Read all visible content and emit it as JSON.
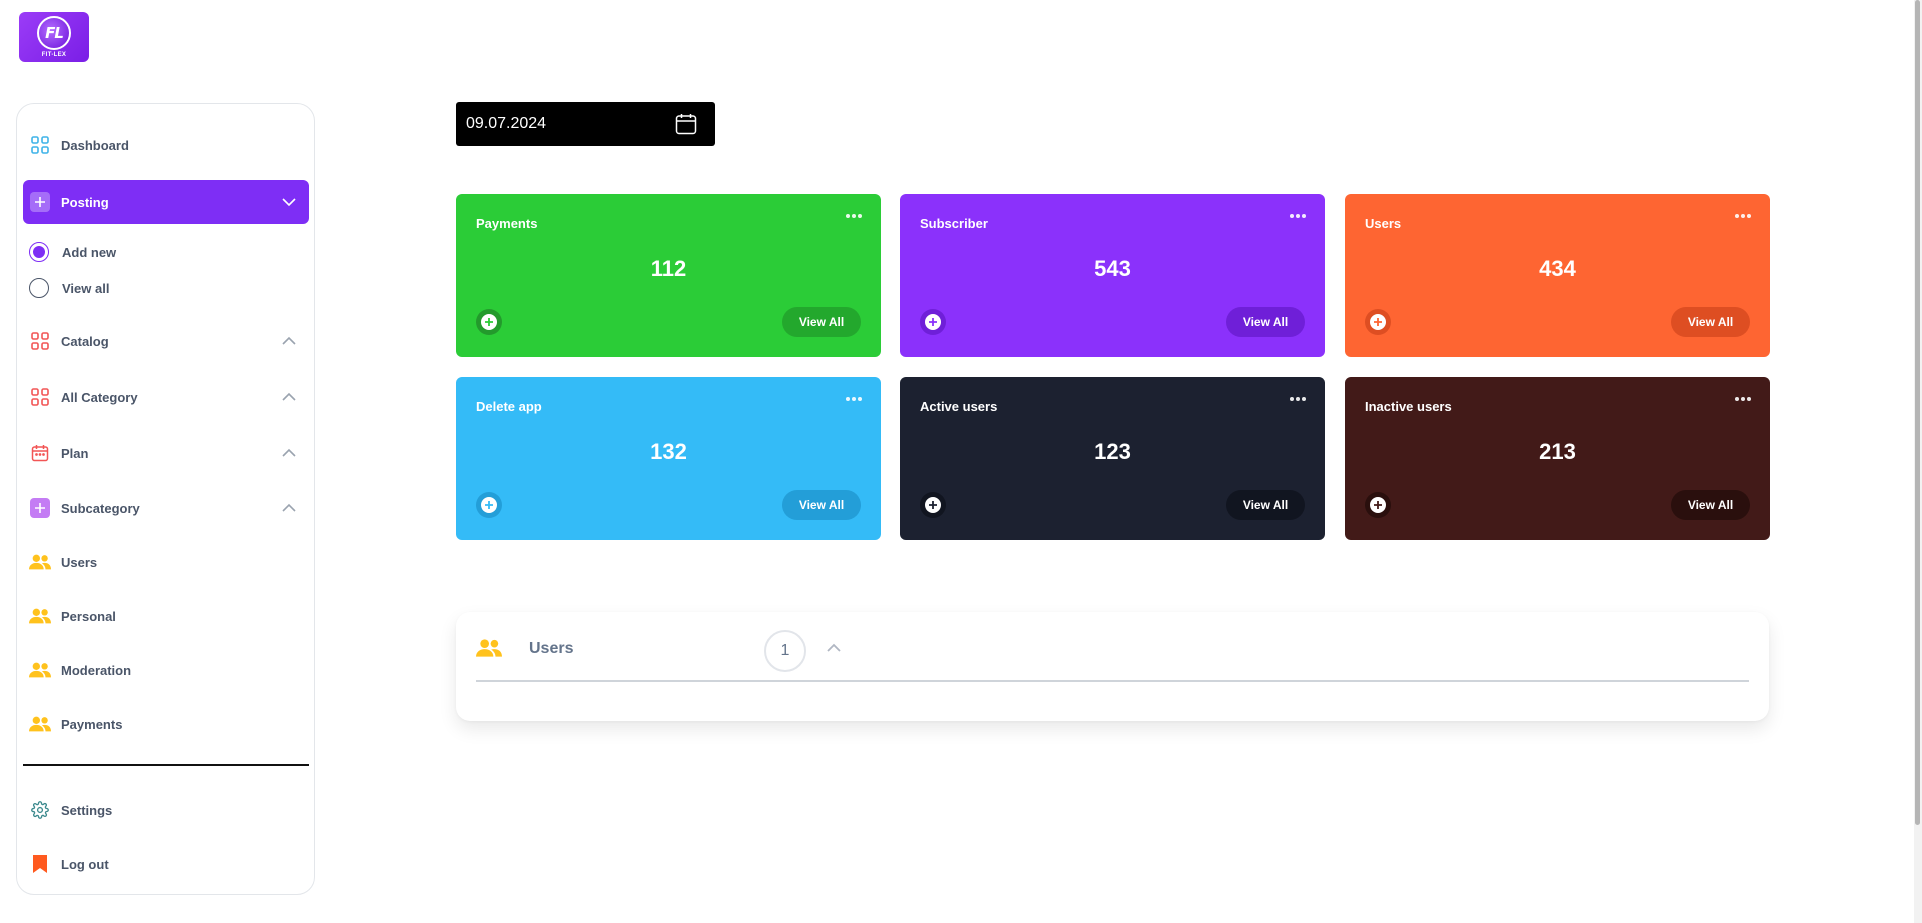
{
  "logo": {
    "letters": "FL",
    "text": "FIT-LEX"
  },
  "sidebar": {
    "dashboard": "Dashboard",
    "posting": "Posting",
    "posting_sub": {
      "add_new": "Add new",
      "view_all": "View all"
    },
    "catalog": "Catalog",
    "all_category": "All Category",
    "plan": "Plan",
    "subcategory": "Subcategory",
    "users": "Users",
    "personal": "Personal",
    "moderation": "Moderation",
    "payments": "Payments",
    "settings": "Settings",
    "logout": "Log out"
  },
  "date": {
    "value": "09.07.2024"
  },
  "cards": [
    {
      "title": "Payments",
      "value": "112",
      "button": "View All",
      "bg": "#2bcc37",
      "btn_bg": "#23a82d",
      "plus_bg": "#239a2c",
      "plus_fg": "#2bcc37"
    },
    {
      "title": "Subscriber",
      "value": "543",
      "button": "View All",
      "bg": "#8b31fb",
      "btn_bg": "#6f1fd8",
      "plus_bg": "#6f1fd8",
      "plus_fg": "#8b31fb"
    },
    {
      "title": "Users",
      "value": "434",
      "button": "View All",
      "bg": "#fe6532",
      "btn_bg": "#de4e22",
      "plus_bg": "#de4e22",
      "plus_fg": "#fe6532"
    },
    {
      "title": "Delete app",
      "value": "132",
      "button": "View All",
      "bg": "#34bbf7",
      "btn_bg": "#239ed8",
      "plus_bg": "#239ed8",
      "plus_fg": "#34bbf7"
    },
    {
      "title": "Active users",
      "value": "123",
      "button": "View All",
      "bg": "#1c2130",
      "btn_bg": "#111520",
      "plus_bg": "#111520",
      "plus_fg": "#1c2130"
    },
    {
      "title": "Inactive users",
      "value": "213",
      "button": "View All",
      "bg": "#421a18",
      "btn_bg": "#2a0f0d",
      "plus_bg": "#2a0f0d",
      "plus_fg": "#421a18"
    }
  ],
  "users_panel": {
    "title": "Users",
    "count": "1"
  },
  "colors": {
    "accent": "#7e2ef5",
    "icon_blue": "#3fb3e8",
    "icon_red": "#f25555",
    "icon_yellow": "#ffc21d",
    "icon_purple": "#c47cf4",
    "icon_orange": "#ff5a1f"
  }
}
